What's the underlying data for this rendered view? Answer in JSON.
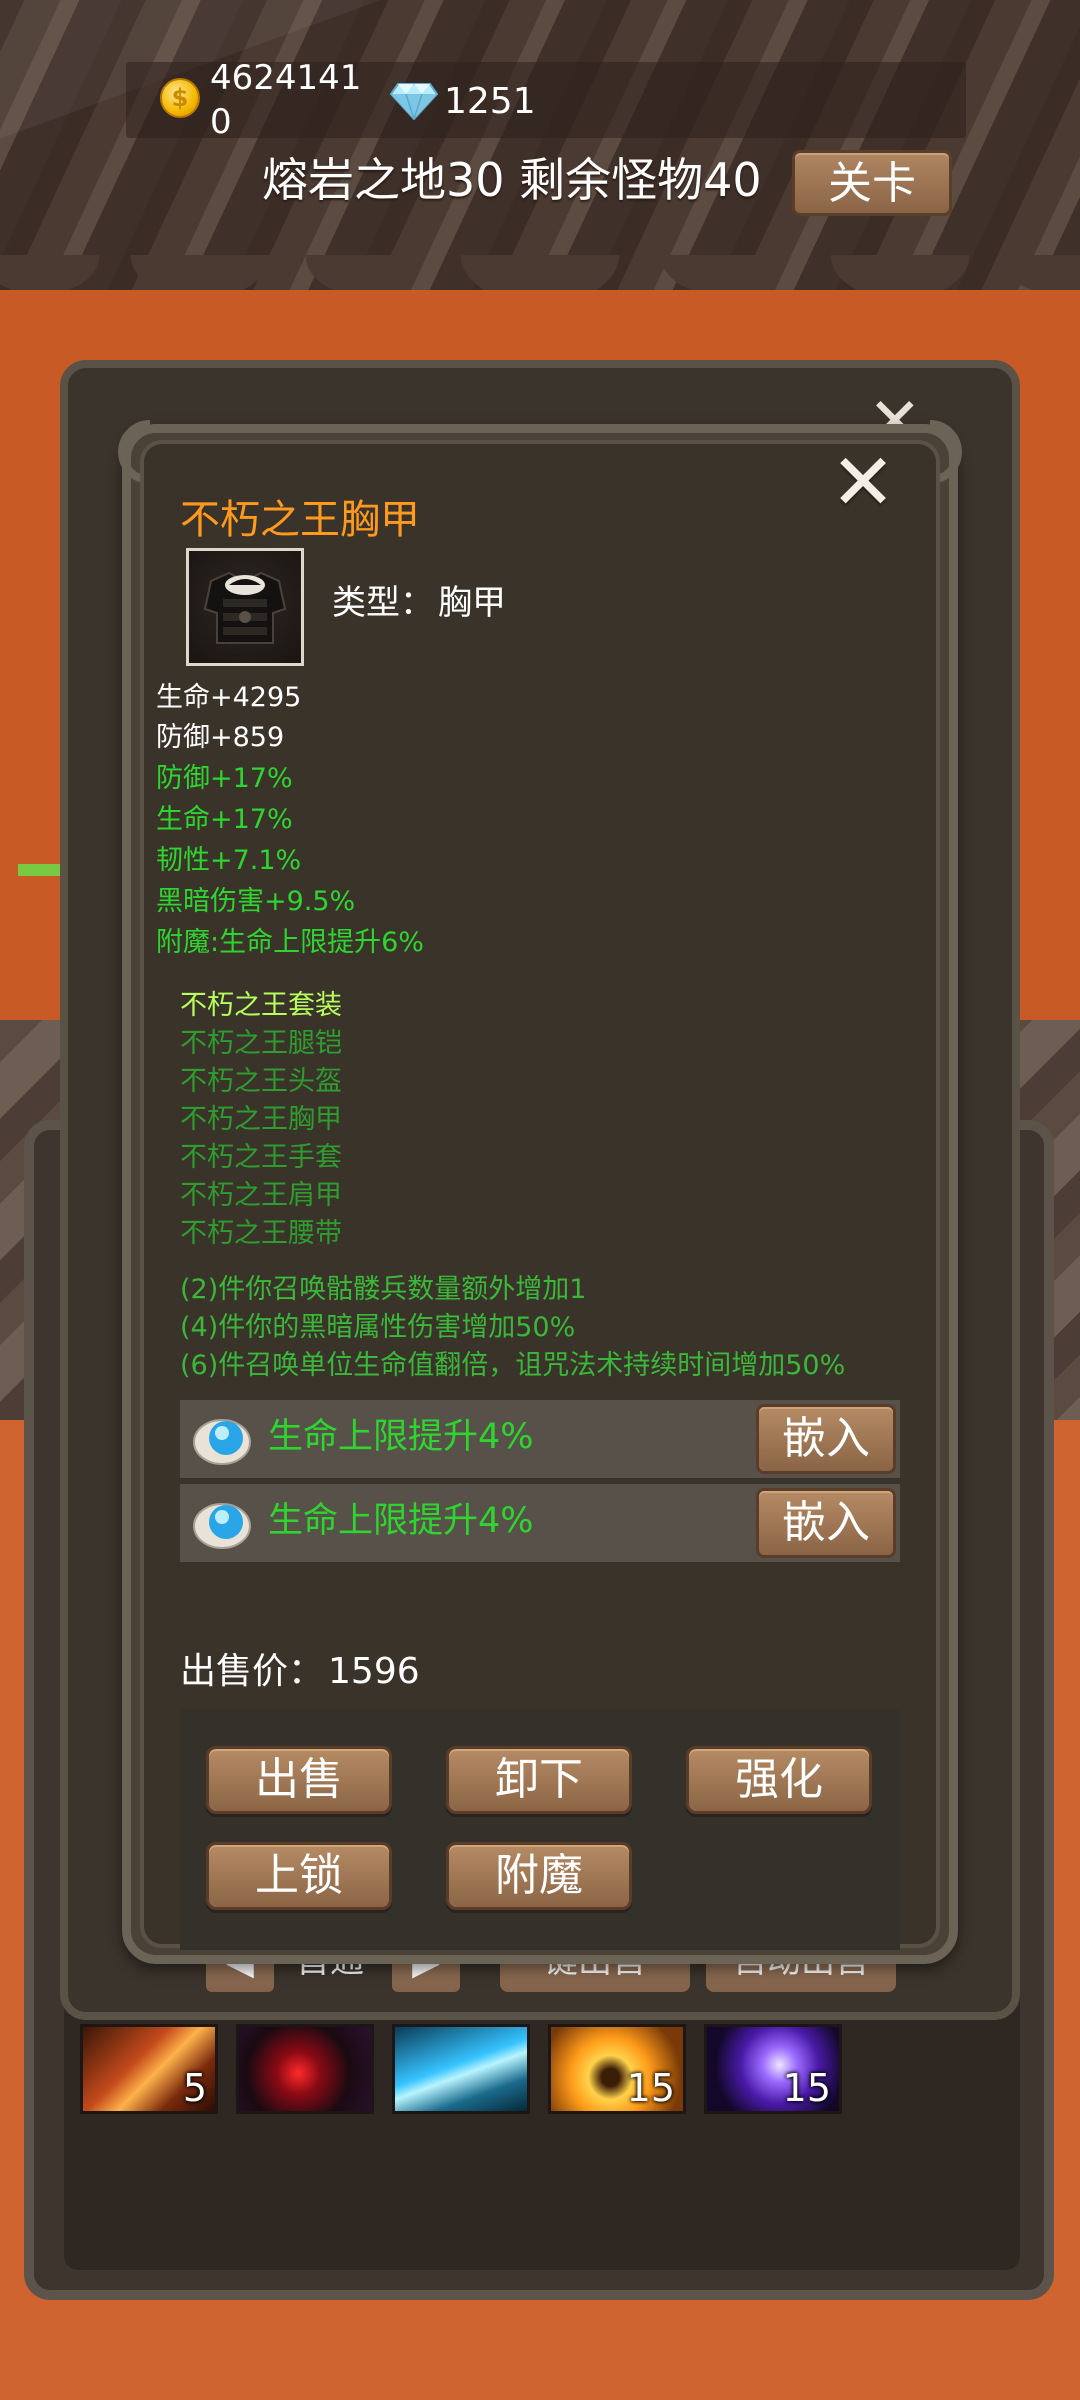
{
  "hud": {
    "gold": "46241410",
    "gems": "1251",
    "stage_text": "熔岩之地30 剩余怪物40",
    "stage_button": "关卡"
  },
  "background_menu": {
    "arrow_left": "◀",
    "page_label": "首通",
    "arrow_right": "▶",
    "btn_one": "键出售",
    "btn_two": "自动出售"
  },
  "skills": [
    {
      "icon": "flame-slash-skill-icon",
      "count": "5"
    },
    {
      "icon": "blood-demon-skill-icon",
      "count": ""
    },
    {
      "icon": "ice-fish-skill-icon",
      "count": ""
    },
    {
      "icon": "golden-burst-skill-icon",
      "count": "15"
    },
    {
      "icon": "void-orb-skill-icon",
      "count": "15"
    }
  ],
  "item": {
    "name": "不朽之王胸甲",
    "type_label": "类型：",
    "type_value": "胸甲",
    "stats": [
      {
        "text": "生命+4295",
        "color": "white"
      },
      {
        "text": "防御+859",
        "color": "white"
      },
      {
        "text": "防御+17%",
        "color": "green"
      },
      {
        "text": "生命+17%",
        "color": "green"
      },
      {
        "text": "韧性+7.1%",
        "color": "green"
      },
      {
        "text": "黑暗伤害+9.5%",
        "color": "green"
      },
      {
        "text": "附魔:生命上限提升6%",
        "color": "green"
      }
    ],
    "set_title": "不朽之王套装",
    "set_pieces": [
      "不朽之王腿铠",
      "不朽之王头盔",
      "不朽之王胸甲",
      "不朽之王手套",
      "不朽之王肩甲",
      "不朽之王腰带"
    ],
    "set_bonuses": [
      "(2)件你召唤骷髅兵数量额外增加1",
      "(4)件你的黑暗属性伤害增加50%",
      "(6)件召唤单位生命值翻倍，诅咒法术持续时间增加50%"
    ],
    "sockets": [
      {
        "text": "生命上限提升4%",
        "button": "嵌入"
      },
      {
        "text": "生命上限提升4%",
        "button": "嵌入"
      }
    ],
    "sell_label": "出售价：",
    "sell_value": "1596",
    "actions": {
      "sell": "出售",
      "unequip": "卸下",
      "enhance": "强化",
      "lock": "上锁",
      "enchant": "附魔"
    }
  },
  "colors": {
    "item_name": "#ff9a1e",
    "green_stat": "#2fd52f",
    "set_title": "#b7ff5c",
    "button_brown": "#a27a57"
  }
}
